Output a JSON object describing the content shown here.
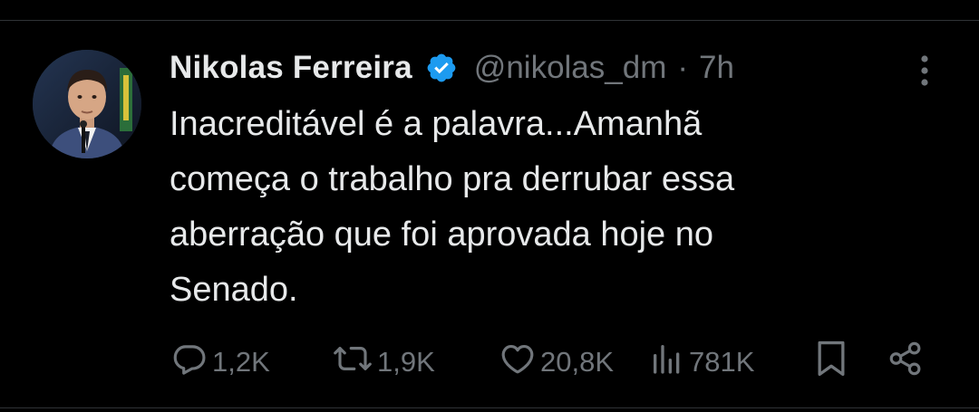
{
  "tweet": {
    "author": {
      "name": "Nikolas Ferreira",
      "handle": "@nikolas_dm",
      "verified": true
    },
    "separator": "·",
    "time": "7h",
    "text": "Inacreditável é a palavra...Amanhã\ncomeça o trabalho pra derrubar essa\naberração que foi aprovada hoje no\nSenado.",
    "stats": {
      "replies": "1,2K",
      "retweets": "1,9K",
      "likes": "20,8K",
      "views": "781K"
    }
  },
  "icons": {
    "verified": "verified-badge-icon",
    "more": "more-vertical-icon",
    "reply": "reply-icon",
    "retweet": "retweet-icon",
    "like": "heart-icon",
    "views": "views-icon",
    "bookmark": "bookmark-icon",
    "share": "share-icon"
  },
  "colors": {
    "background": "#000000",
    "text_primary": "#e7e9ea",
    "text_secondary": "#71767b",
    "verified_blue": "#1d9bf0",
    "divider": "#2f3336"
  }
}
